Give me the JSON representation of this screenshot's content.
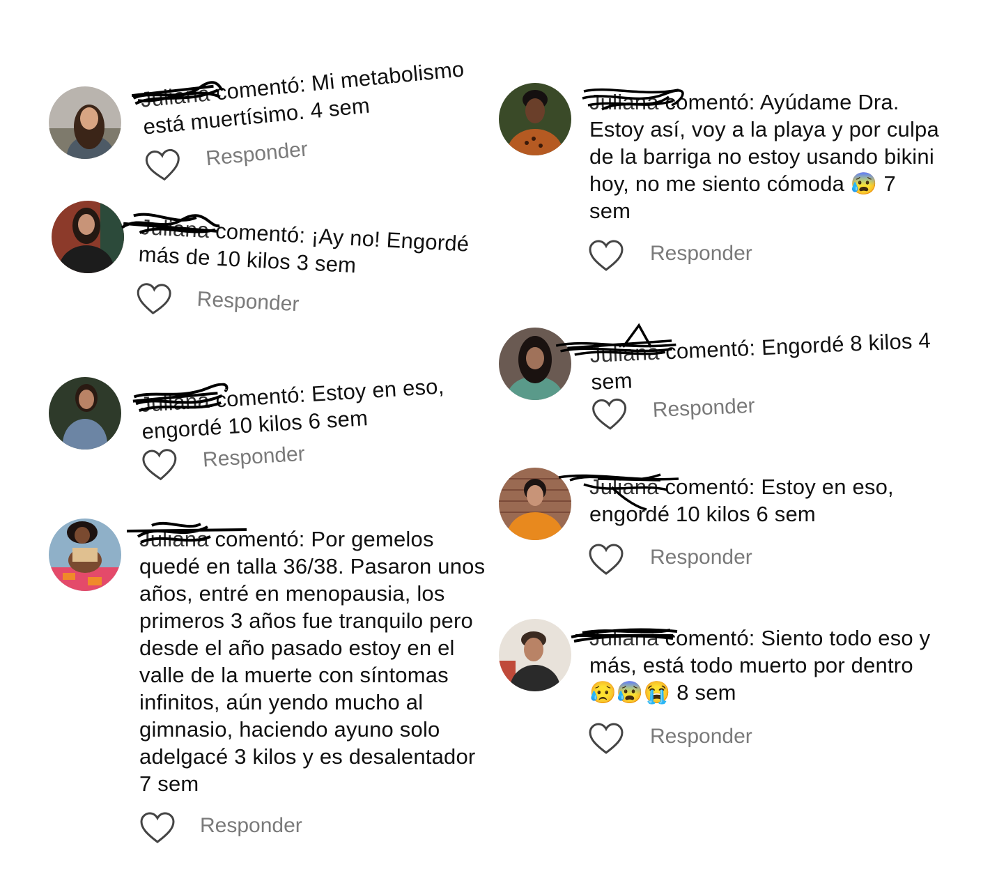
{
  "comment_verb": "comentó:",
  "reply_label": "Responder",
  "comments": [
    {
      "username": "Juliana",
      "text": "Mi metabolismo está muertísimo.",
      "time": "4 sem"
    },
    {
      "username": "Juliana",
      "text": "¡Ay no! Engordé más de 10 kilos",
      "time": "3 sem"
    },
    {
      "username": "Juliana",
      "text": "Estoy en eso, engordé 10 kilos",
      "time": "6 sem"
    },
    {
      "username": "Juliana",
      "text": "Por gemelos quedé en talla 36/38. Pasaron unos años, entré en menopausia, los primeros 3 años fue tranquilo pero desde el año pasado estoy en el valle de la muerte con síntomas infinitos, aún yendo mucho al gimnasio, haciendo ayuno solo adelgacé 3 kilos y es desalentador",
      "time": "7 sem"
    },
    {
      "username": "Juliana",
      "text": "Ayúdame Dra. Estoy así, voy a la playa y por culpa de la barriga no estoy usando bikini hoy, no me siento cómoda 😰",
      "time": "7 sem"
    },
    {
      "username": "Juliana",
      "text": "Engordé 8 kilos",
      "time": "4 sem"
    },
    {
      "username": "Juliana",
      "text": "Estoy en eso, engordé 10 kilos",
      "time": "6 sem"
    },
    {
      "username": "Juliana",
      "text": "Siento todo eso y más, está todo muerto por dentro 😥😰😭",
      "time": "8 sem"
    }
  ],
  "colors": {
    "text": "#111111",
    "reply": "#7a7a7a",
    "heart": "#444444",
    "scribble": "#000000"
  }
}
